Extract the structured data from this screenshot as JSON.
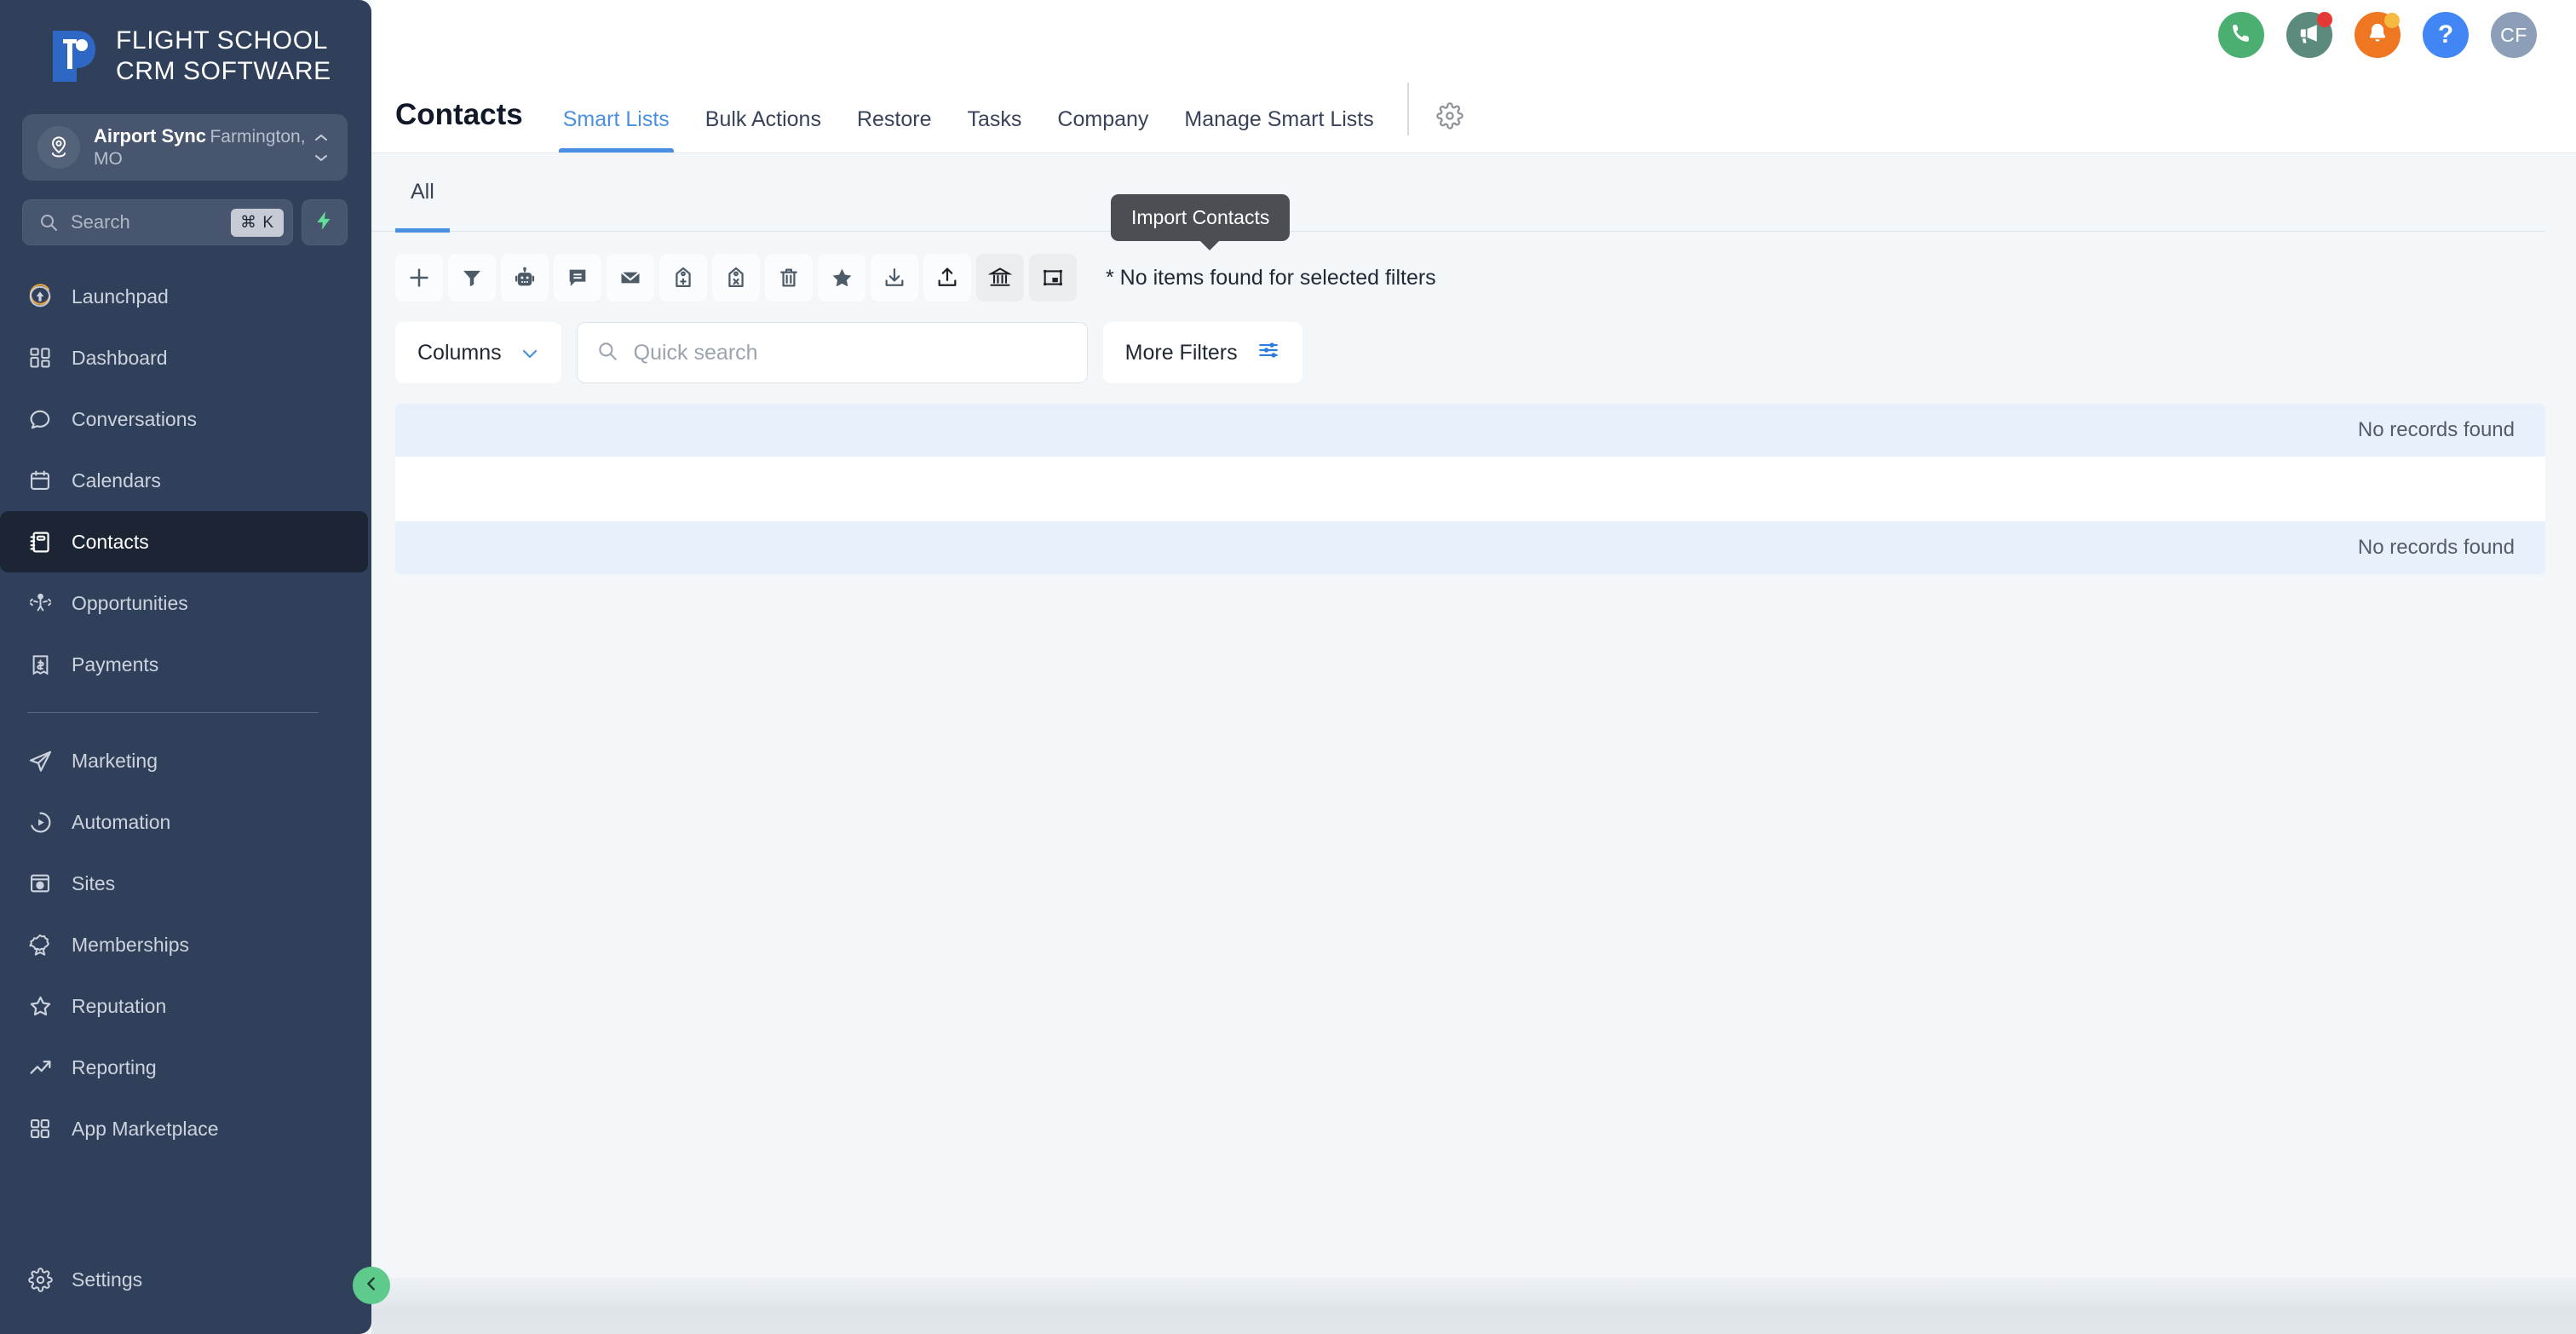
{
  "sidebar": {
    "logo": {
      "line1": "FLIGHT SCHOOL",
      "line2": "CRM SOFTWARE",
      "icon": "flight-school-crm-logo"
    },
    "org": {
      "name": "Airport Sync",
      "location": "Farmington, MO",
      "avatar_icon": "location-pin-icon",
      "caret_icon": "chevron-up-down-icon"
    },
    "search": {
      "placeholder": "Search",
      "shortcut": "⌘ K",
      "icon": "search-icon",
      "bolt_icon": "lightning-bolt-icon"
    },
    "items": [
      {
        "label": "Launchpad",
        "icon": "rocket-launch-icon",
        "active": false
      },
      {
        "label": "Dashboard",
        "icon": "dashboard-grid-icon",
        "active": false
      },
      {
        "label": "Conversations",
        "icon": "chat-bubble-icon",
        "active": false
      },
      {
        "label": "Calendars",
        "icon": "calendar-icon",
        "active": false
      },
      {
        "label": "Contacts",
        "icon": "contact-book-icon",
        "active": true
      },
      {
        "label": "Opportunities",
        "icon": "opportunities-icon",
        "active": false
      },
      {
        "label": "Payments",
        "icon": "payments-bill-icon",
        "active": false
      }
    ],
    "items_secondary": [
      {
        "label": "Marketing",
        "icon": "paper-plane-icon",
        "active": false
      },
      {
        "label": "Automation",
        "icon": "play-circle-icon",
        "active": false
      },
      {
        "label": "Sites",
        "icon": "browser-globe-icon",
        "active": false
      },
      {
        "label": "Memberships",
        "icon": "award-ribbon-icon",
        "active": false
      },
      {
        "label": "Reputation",
        "icon": "star-outline-icon",
        "active": false
      },
      {
        "label": "Reporting",
        "icon": "trending-up-icon",
        "active": false
      },
      {
        "label": "App Marketplace",
        "icon": "app-grid-icon",
        "active": false
      }
    ],
    "items_footer": [
      {
        "label": "Settings",
        "icon": "gear-icon",
        "active": false
      }
    ],
    "collapse_icon": "chevron-left-icon"
  },
  "header": {
    "title": "Contacts",
    "tabs": [
      {
        "label": "Smart Lists",
        "active": true
      },
      {
        "label": "Bulk Actions",
        "active": false
      },
      {
        "label": "Restore",
        "active": false
      },
      {
        "label": "Tasks",
        "active": false
      },
      {
        "label": "Company",
        "active": false
      },
      {
        "label": "Manage Smart Lists",
        "active": false
      }
    ],
    "settings_icon": "gear-icon",
    "actions": [
      {
        "name": "call-button",
        "icon": "phone-icon",
        "color": "#4caf72",
        "badge": null
      },
      {
        "name": "announcements-button",
        "icon": "megaphone-icon",
        "color": "#5c8a7d",
        "badge": "red"
      },
      {
        "name": "notifications-button",
        "icon": "bell-icon",
        "color": "#ef7722",
        "badge": "yellow"
      },
      {
        "name": "help-button",
        "icon": "question-icon",
        "color": "#4285f4",
        "badge": null
      }
    ],
    "avatar_initials": "CF"
  },
  "main": {
    "list_tabs": [
      {
        "label": "All",
        "active": true
      }
    ],
    "toolbar": [
      {
        "name": "add-contact-button",
        "icon": "plus-icon",
        "dim": false
      },
      {
        "name": "filter-button",
        "icon": "funnel-icon",
        "dim": false
      },
      {
        "name": "add-to-automation-button",
        "icon": "robot-icon",
        "dim": false
      },
      {
        "name": "send-sms-button",
        "icon": "message-icon",
        "dim": false
      },
      {
        "name": "send-email-button",
        "icon": "envelope-icon",
        "dim": false
      },
      {
        "name": "add-tag-button",
        "icon": "tag-plus-icon",
        "dim": false
      },
      {
        "name": "remove-tag-button",
        "icon": "tag-remove-icon",
        "dim": false
      },
      {
        "name": "delete-button",
        "icon": "trash-icon",
        "dim": false
      },
      {
        "name": "favorite-button",
        "icon": "star-filled-icon",
        "dim": false
      },
      {
        "name": "export-contacts-button",
        "icon": "download-icon",
        "dim": false
      },
      {
        "name": "import-contacts-button",
        "icon": "upload-icon",
        "dim": false
      },
      {
        "name": "bank-button",
        "icon": "bank-icon",
        "dim": true
      },
      {
        "name": "restore-view-button",
        "icon": "crop-frame-icon",
        "dim": true
      }
    ],
    "tooltip": {
      "text": "Import Contacts",
      "for": "import-contacts-button"
    },
    "status_text": "* No items found for selected filters",
    "columns_label": "Columns",
    "columns_caret_icon": "chevron-down-icon",
    "quick_search": {
      "placeholder": "Quick search",
      "value": "",
      "icon": "search-icon"
    },
    "more_filters_label": "More Filters",
    "more_filters_icon": "sliders-icon",
    "table": {
      "header_text": "No records found",
      "footer_text": "No records found"
    }
  },
  "colors": {
    "sidebar_bg": "#30405a",
    "sidebar_active": "#1c2533",
    "accent_blue": "#4a90e2",
    "content_bg": "#f4f7fa",
    "row_blue": "#e8f1fb",
    "green": "#5ecb8d"
  }
}
